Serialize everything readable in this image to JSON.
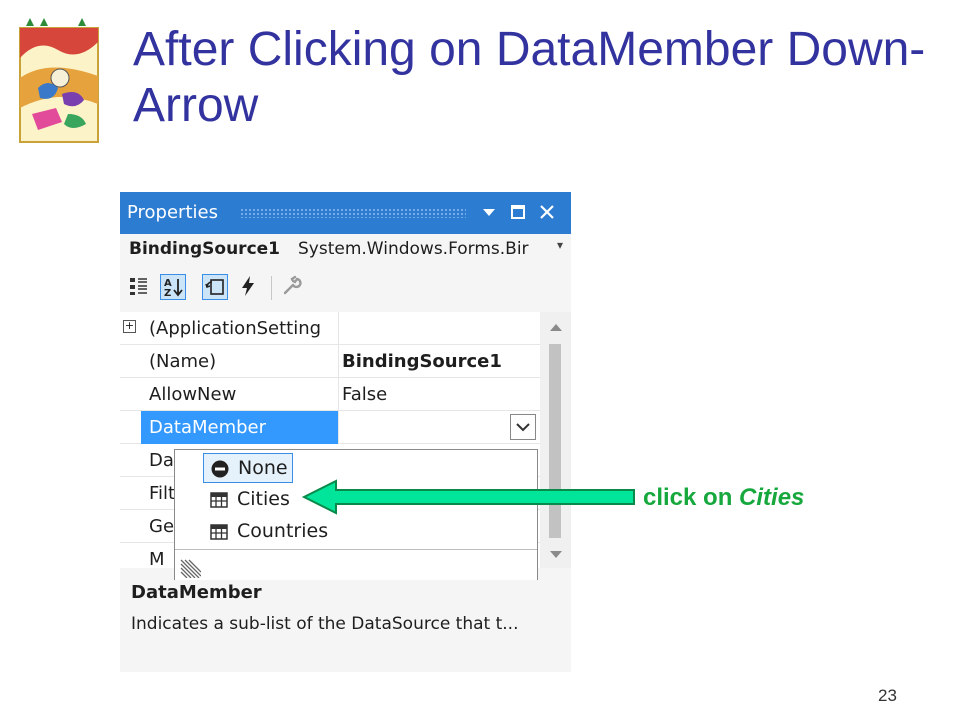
{
  "slide": {
    "title": "After Clicking on DataMember Down-Arrow",
    "page_number": "23"
  },
  "window": {
    "title": "Properties",
    "object_name": "BindingSource1",
    "object_type": "System.Windows.Forms.Bir",
    "properties": [
      {
        "name": "(ApplicationSetting",
        "value": "",
        "expandable": true
      },
      {
        "name": "(Name)",
        "value": "BindingSource1",
        "bold": true
      },
      {
        "name": "AllowNew",
        "value": "False"
      },
      {
        "name": "DataMember",
        "value": "",
        "selected": true
      },
      {
        "name": "Da",
        "value": ""
      },
      {
        "name": "Filt",
        "value": ""
      },
      {
        "name": "Ge",
        "value": ""
      },
      {
        "name": "M",
        "value": ""
      }
    ],
    "dropdown_items": [
      {
        "label": "None",
        "icon": "none-circle-icon",
        "selected": true
      },
      {
        "label": "Cities",
        "icon": "table-icon"
      },
      {
        "label": "Countries",
        "icon": "table-icon"
      }
    ],
    "description_title": "DataMember",
    "description_text": "Indicates a sub-list of the DataSource that t..."
  },
  "annotation": {
    "text_prefix": "click on ",
    "text_emphasis": "Cities",
    "color": "#17a83d",
    "arrow_color": "#00e59a"
  },
  "colors": {
    "title": "#3333a0",
    "titlebar": "#2c7cd2",
    "selection": "#3399ff"
  }
}
